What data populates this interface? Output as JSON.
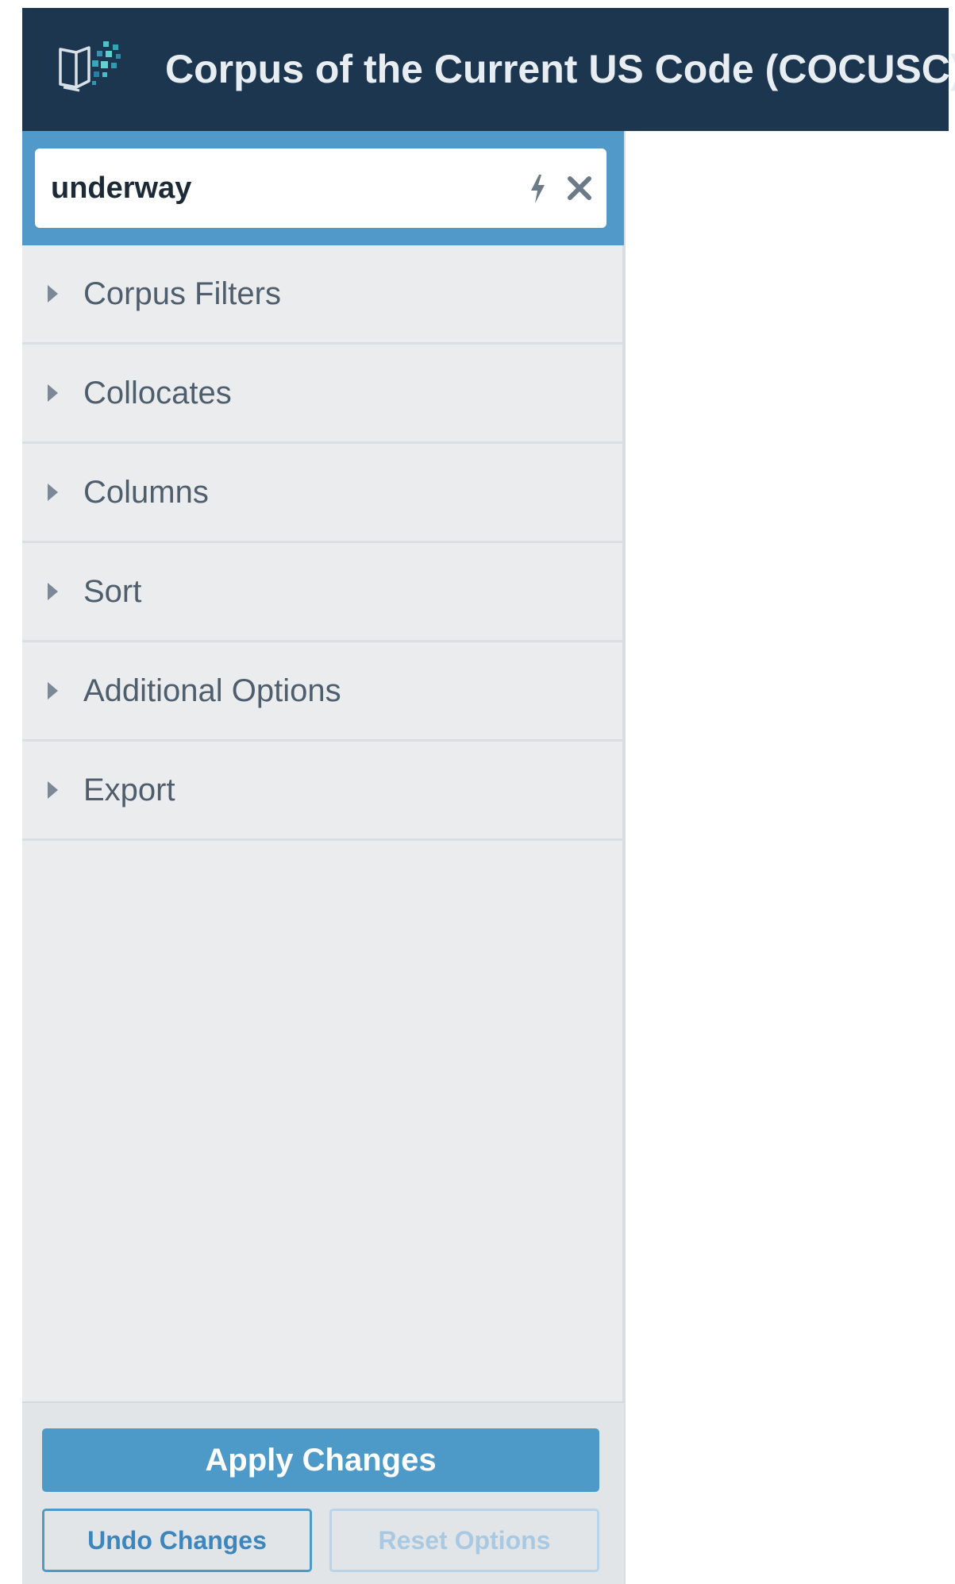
{
  "header": {
    "title": "Corpus of the Current US Code (COCUSC)",
    "logo_icon": "book-pixel-logo-icon",
    "background_color": "#1c3650"
  },
  "search": {
    "value": "underway",
    "bolt_icon": "lightning-bolt-icon",
    "clear_icon": "close-icon",
    "accent_color": "#5199c8"
  },
  "sections": [
    {
      "label": "Corpus Filters"
    },
    {
      "label": "Collocates"
    },
    {
      "label": "Columns"
    },
    {
      "label": "Sort"
    },
    {
      "label": "Additional Options"
    },
    {
      "label": "Export"
    }
  ],
  "footer": {
    "apply_label": "Apply Changes",
    "undo_label": "Undo Changes",
    "reset_label": "Reset Options"
  }
}
